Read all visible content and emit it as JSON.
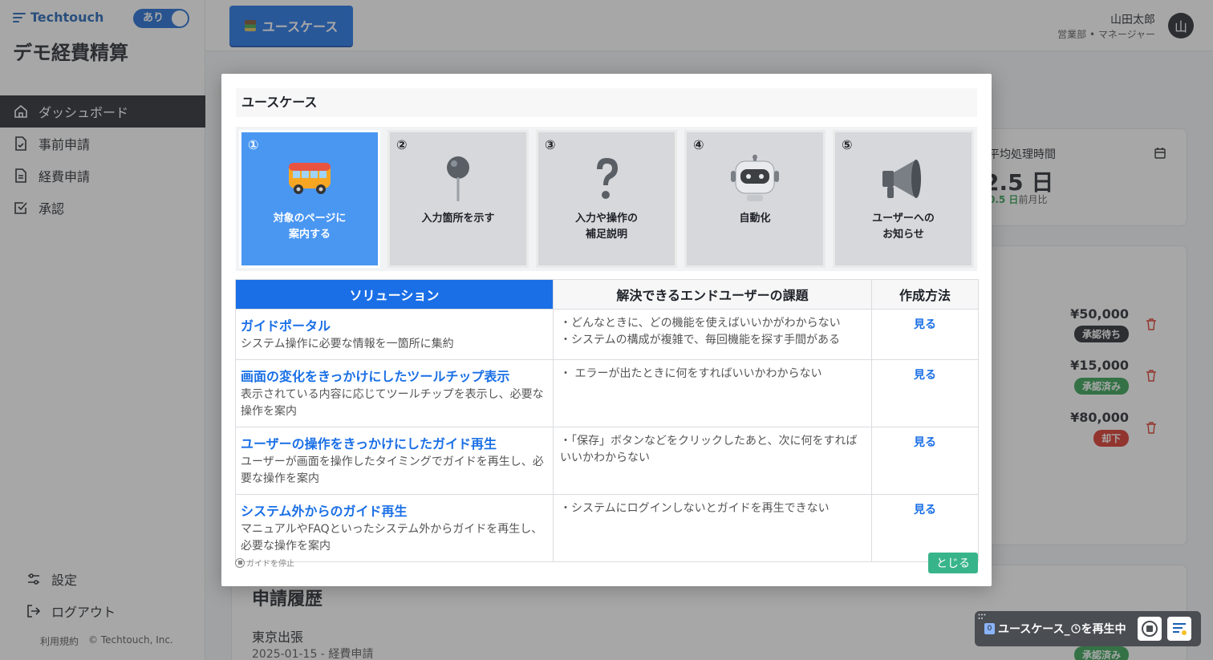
{
  "brand": {
    "name": "Techtouch",
    "color": "#1a5fb4"
  },
  "toggle": {
    "label": "あり"
  },
  "app_title": "デモ経費精算",
  "sidebar": {
    "items": [
      {
        "label": "ダッシュボード",
        "icon": "home-icon",
        "active": true
      },
      {
        "label": "事前申請",
        "icon": "file-check-icon"
      },
      {
        "label": "経費申請",
        "icon": "file-text-icon"
      },
      {
        "label": "承認",
        "icon": "check-square-icon"
      }
    ],
    "bottom": [
      {
        "label": "設定",
        "icon": "sliders-icon"
      },
      {
        "label": "ログアウト",
        "icon": "logout-icon"
      }
    ],
    "footer": {
      "terms": "利用規約",
      "copyright": "© Techtouch, Inc."
    }
  },
  "header": {
    "usecase_button": "ユースケース",
    "user_name": "山田太郎",
    "user_role": "営業部 • マネージャー",
    "avatar": "山"
  },
  "dashboard": {
    "stat_label": "平均処理時間",
    "stat_value": "2.5 日",
    "stat_delta_value": "0.5 日",
    "stat_delta_suffix": "前月比",
    "requests": [
      {
        "amount": "¥50,000",
        "status": "承認待ち",
        "status_color": "#1f2329"
      },
      {
        "amount": "¥15,000",
        "status": "承認済み",
        "status_color": "#2e9e4f"
      },
      {
        "amount": "¥80,000",
        "status": "却下",
        "status_color": "#d93025"
      }
    ],
    "history_title": "申請履歴",
    "history_item": "東京出張",
    "history_sub": "2025-01-15 - 経費申請",
    "history_badge": "承認済み"
  },
  "modal": {
    "title": "ユースケース",
    "steps": [
      {
        "num": "①",
        "label": "対象のページに\n案内する",
        "icon": "bus-icon"
      },
      {
        "num": "②",
        "label": "入力箇所を示す",
        "icon": "pushpin-icon"
      },
      {
        "num": "③",
        "label": "入力や操作の\n補足説明",
        "icon": "question-icon"
      },
      {
        "num": "④",
        "label": "自動化",
        "icon": "robot-icon"
      },
      {
        "num": "⑤",
        "label": "ユーザーへの\nお知らせ",
        "icon": "megaphone-icon"
      }
    ],
    "table": {
      "headers": [
        "ソリューション",
        "解決できるエンドユーザーの課題",
        "作成方法"
      ],
      "rows": [
        {
          "title": "ガイドポータル",
          "desc": "システム操作に必要な情報を一箇所に集約",
          "issues": [
            "・どんなときに、どの機能を使えばいいかがわからない",
            "・システムの構成が複雑で、毎回機能を探す手間がある"
          ],
          "link": "見る"
        },
        {
          "title": "画面の変化をきっかけにしたツールチップ表示",
          "desc": "表示されている内容に応じてツールチップを表示し、必要な操作を案内",
          "issues": [
            "・ エラーが出たときに何をすればいいかわからない"
          ],
          "link": "見る"
        },
        {
          "title": "ユーザーの操作をきっかけにしたガイド再生",
          "desc": "ユーザーが画面を操作したタイミングでガイドを再生し、必要な操作を案内",
          "issues": [
            "・「保存」ボタンなどをクリックしたあと、次に何をすればいいかわからない"
          ],
          "link": "見る"
        },
        {
          "title": "システム外からのガイド再生",
          "desc": "マニュアルやFAQといったシステム外からガイドを再生し、必要な操作を案内",
          "issues": [
            "・システムにログインしないとガイドを再生できない"
          ],
          "link": "見る"
        }
      ]
    },
    "stop_guide": "ガイドを停止",
    "close": "とじる"
  },
  "player": {
    "num": "0",
    "label": "ユースケース_",
    "suffix": " を再生中"
  },
  "colors": {
    "accent": "#1a6fe6",
    "close_button": "#38b48b",
    "active_step": "#4a97f2"
  }
}
